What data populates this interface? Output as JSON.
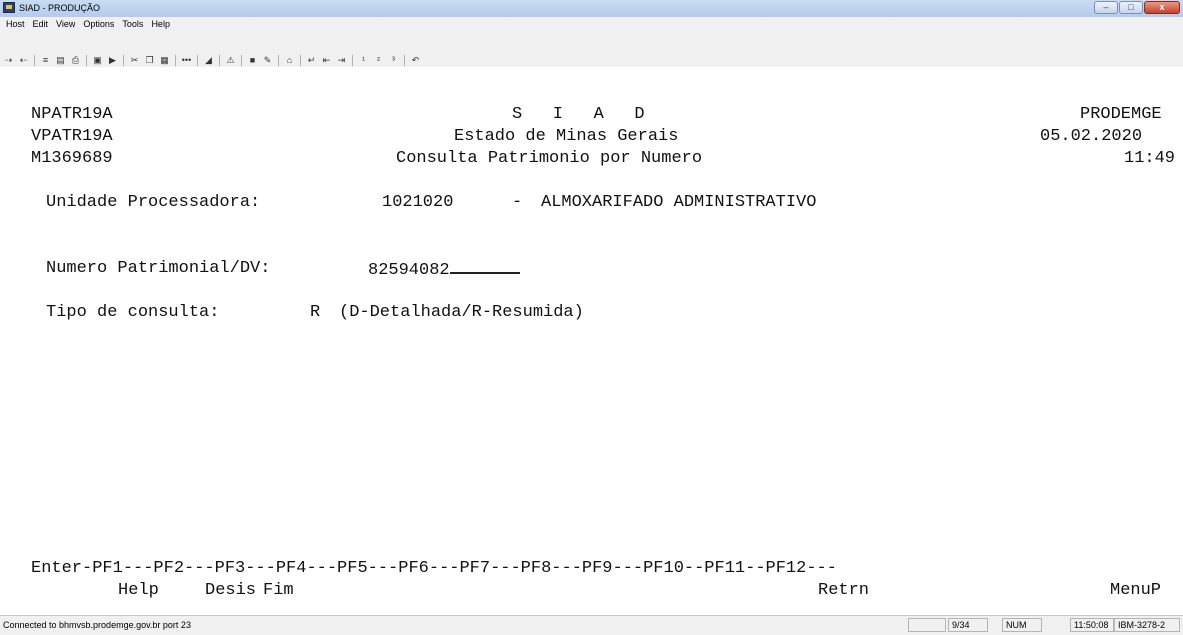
{
  "window": {
    "title": "SIAD - PRODUÇÃO",
    "controls": {
      "minimize": "–",
      "maximize": "□",
      "close": "x"
    }
  },
  "menu": [
    "Host",
    "Edit",
    "View",
    "Options",
    "Tools",
    "Help"
  ],
  "toolbar": {
    "icons": [
      "send-icon",
      "receive-icon",
      "transfer-icon",
      "copy-screen-icon",
      "print-icon",
      "macro-icon",
      "macro-run-icon",
      "cut-icon",
      "copy-icon",
      "paste-icon",
      "dots-icon",
      "graph-icon",
      "warning-icon",
      "screen-icon",
      "pencil-icon",
      "home-icon",
      "enter-icon",
      "left-tab-icon",
      "right-tab-icon",
      "pa1-icon",
      "pa2-icon",
      "pa3-icon",
      "undo-icon"
    ]
  },
  "terminal": {
    "program_id": "NPATR19A",
    "screen_id": "VPATR19A",
    "user_id": "M1369689",
    "system_name": "S   I   A   D",
    "state": "Estado de Minas Gerais",
    "screen_title": "Consulta Patrimonio por Numero",
    "company": "PRODEMGE",
    "date": "05.02.2020",
    "time": "11:49",
    "unidade_label": "Unidade Processadora:",
    "unidade_code": "1021020",
    "unidade_sep": "-",
    "unidade_name": "ALMOXARIFADO ADMINISTRATIVO",
    "numero_label": "Numero Patrimonial/DV:",
    "numero_value": "82594082",
    "tipo_label": "Tipo de consulta:",
    "tipo_value": "R",
    "tipo_hint": "(D-Detalhada/R-Resumida)",
    "pf_keys_line": "Enter-PF1---PF2---PF3---PF4---PF5---PF6---PF7---PF8---PF9---PF10--PF11--PF12---",
    "pf_help": "Help",
    "pf_desis": "Desis",
    "pf_fim": "Fim",
    "pf_retrn": "Retrn",
    "pf_menup": "MenuP"
  },
  "status": {
    "connection": "Connected to bhmvsb.prodemge.gov.br port 23",
    "cursor": "9/34",
    "num": "NUM",
    "clock": "11:50:08",
    "model": "IBM-3278-2"
  }
}
